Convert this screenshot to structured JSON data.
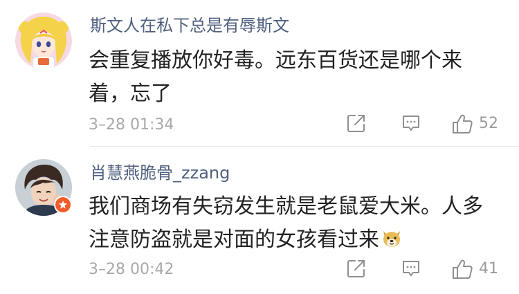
{
  "comments": [
    {
      "username": "斯文人在私下总是有辱斯文",
      "text": "会重复播放你好毒。远东百货还是哪个来着，忘了",
      "timestamp": "3–28 01:34",
      "likes": "52",
      "avatar_icon": "anime-girl-avatar",
      "verified_badge": false
    },
    {
      "username": "肖慧燕脆骨_zzang",
      "text": "我们商场有失窃发生就是老鼠爱大米。人多注意防盗就是对面的女孩看过来",
      "timestamp": "3–28 00:42",
      "likes": "41",
      "avatar_icon": "young-man-avatar",
      "verified_badge": true,
      "trailing_emoji": "doge-emoji"
    }
  ],
  "actions": {
    "share_icon": "share-icon",
    "reply_icon": "comment-icon",
    "like_icon": "thumbs-up-icon"
  },
  "colors": {
    "username": "#4f5f7f",
    "text": "#222222",
    "meta": "#a8a8a8",
    "badge": "#f25c2a",
    "divider": "#e6e6e6"
  }
}
